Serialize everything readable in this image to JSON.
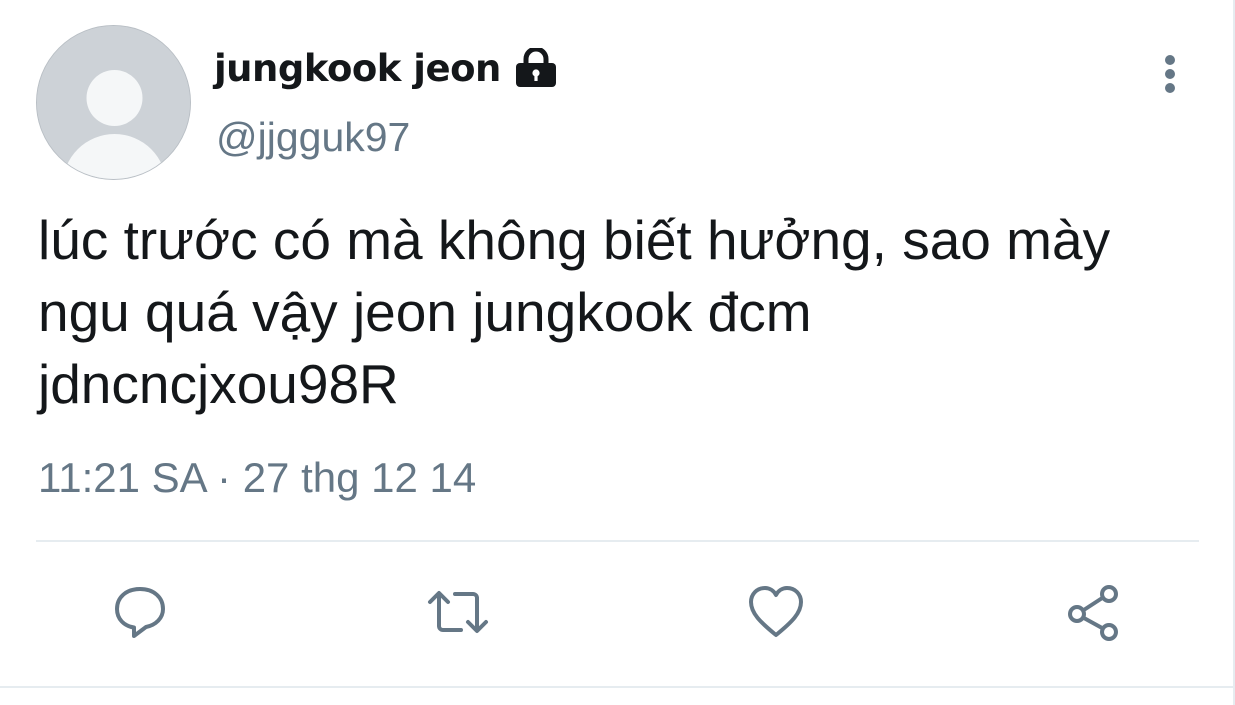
{
  "tweet": {
    "author": {
      "display_name": "jungkook jeon",
      "handle": "@jjgguk97",
      "protected_icon": "lock-icon",
      "avatar_icon": "default-avatar"
    },
    "more_icon": "vertical-dots-icon",
    "text": "lúc trước có mà không biết hưởng, sao mày\nngu quá vậy jeon jungkook đcm\njdncncjxou98R",
    "timestamp": "11:21 SA · 27 thg 12 14",
    "actions": [
      {
        "name": "reply",
        "icon": "reply-icon"
      },
      {
        "name": "retweet",
        "icon": "retweet-icon"
      },
      {
        "name": "like",
        "icon": "heart-icon"
      },
      {
        "name": "share",
        "icon": "share-icon"
      }
    ]
  },
  "colors": {
    "text_primary": "#14171a",
    "text_secondary": "#657786",
    "divider": "#e6ecf0",
    "avatar_bg": "#cdd2d7",
    "avatar_figure": "#f5f7f8"
  }
}
